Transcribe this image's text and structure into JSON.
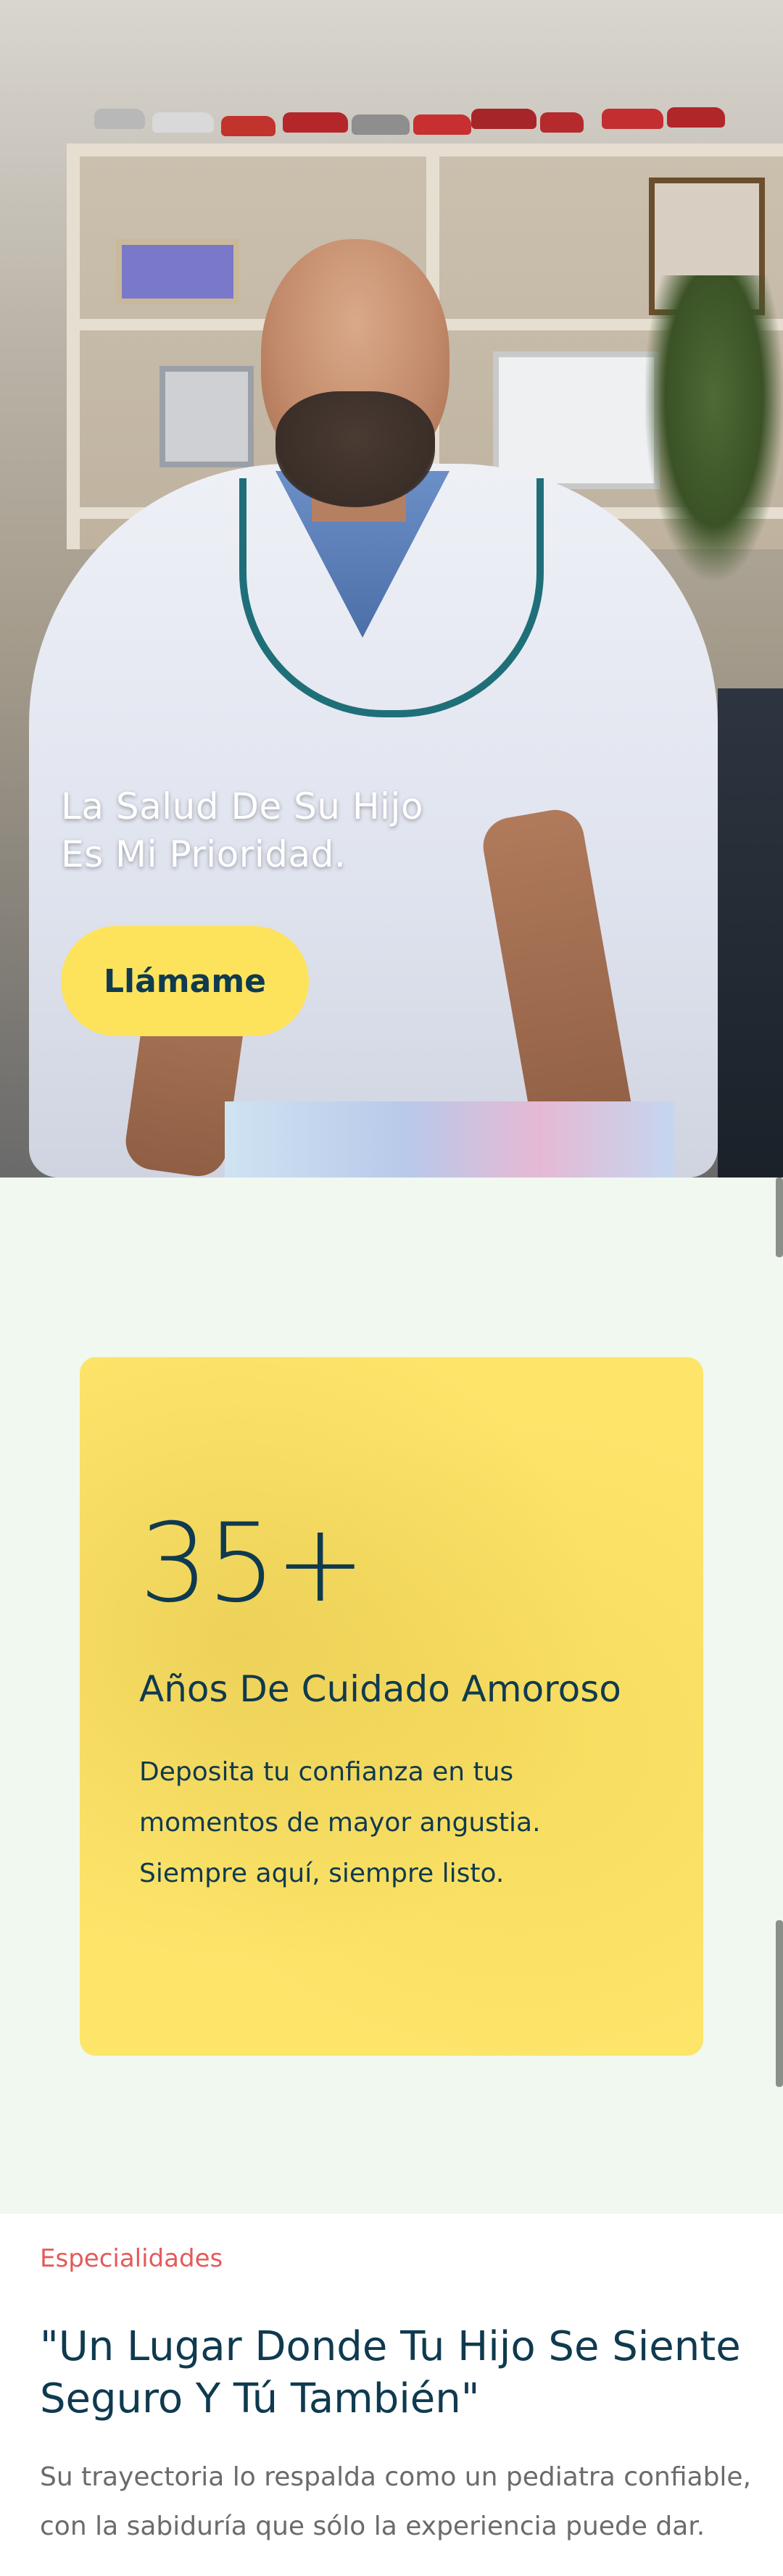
{
  "hero": {
    "title_line1": "La Salud De Su Hijo",
    "title_line2": "Es Mi Prioridad.",
    "cta_label": "Llámame"
  },
  "stats": {
    "number": "35+",
    "title": "Años De Cuidado Amoroso",
    "text_line1": "Deposita tu confianza en tus",
    "text_line2": "momentos de mayor angustia.",
    "text_line3": "Siempre aquí, siempre listo."
  },
  "specialties": {
    "eyebrow": "Especialidades",
    "title_line1": "\"Un Lugar Donde Tu Hijo Se Siente",
    "title_line2": "Seguro Y Tú También\"",
    "text_line1": "Su trayectoria lo respalda como un pediatra confiable,",
    "text_line2": "con la sabiduría que sólo la experiencia puede dar."
  },
  "colors": {
    "accent_yellow": "#fde35c",
    "dark_teal": "#0f3a4f",
    "eyebrow_red": "#e55a5a",
    "section_bg": "#f0f8f0"
  }
}
